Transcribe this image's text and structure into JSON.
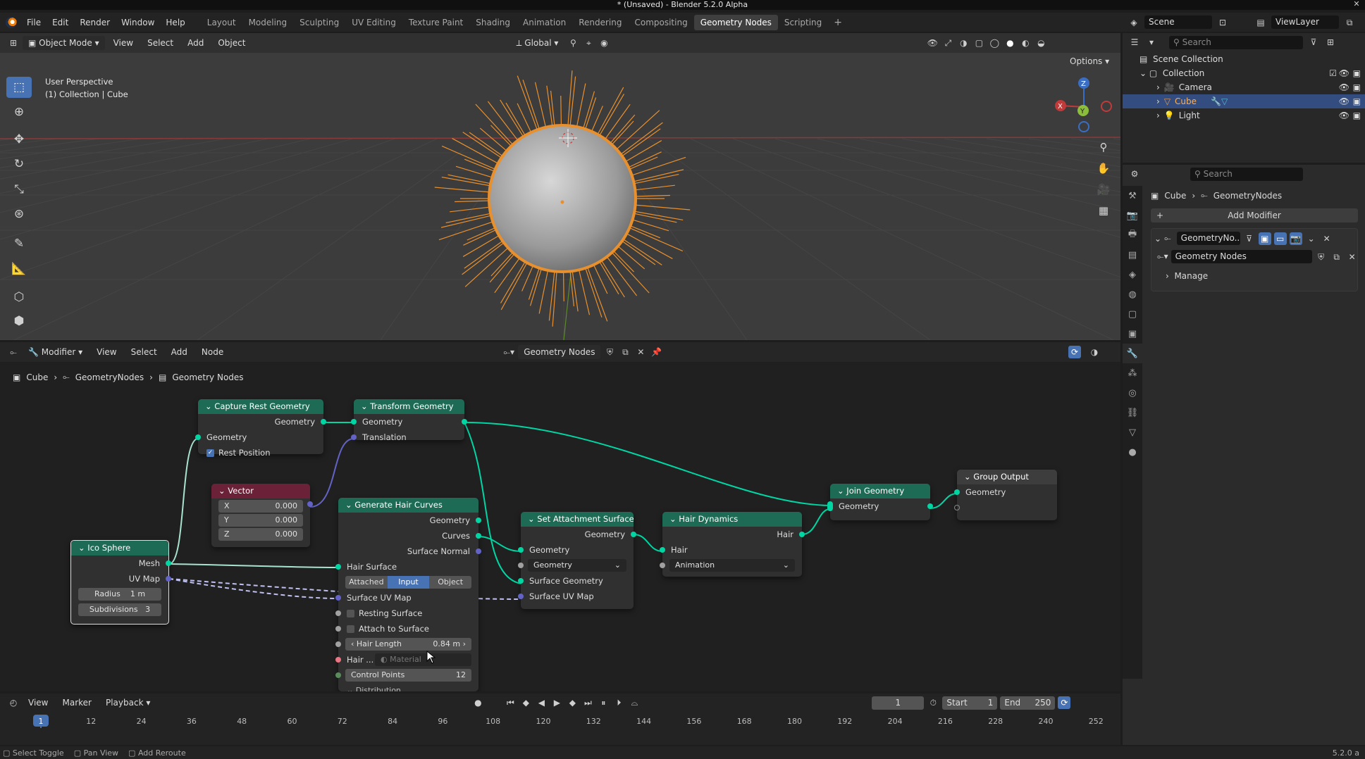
{
  "window": {
    "title": "* (Unsaved) - Blender 5.2.0 Alpha"
  },
  "menu": {
    "items": [
      "File",
      "Edit",
      "Render",
      "Window",
      "Help"
    ],
    "workspaces": [
      "Layout",
      "Modeling",
      "Sculpting",
      "UV Editing",
      "Texture Paint",
      "Shading",
      "Animation",
      "Rendering",
      "Compositing",
      "Geometry Nodes",
      "Scripting"
    ],
    "active_workspace": "Geometry Nodes",
    "scene": "Scene",
    "view_layer": "ViewLayer"
  },
  "viewport": {
    "mode": "Object Mode",
    "menus": [
      "View",
      "Select",
      "Add",
      "Object"
    ],
    "orientation": "Global",
    "options": "Options",
    "info_line1": "User Perspective",
    "info_line2": "(1) Collection | Cube",
    "gizmo": {
      "x": "X",
      "y": "Y",
      "z": "Z"
    }
  },
  "outliner": {
    "search_placeholder": "Search",
    "scene_collection": "Scene Collection",
    "collection": "Collection",
    "items": [
      {
        "name": "Camera"
      },
      {
        "name": "Cube"
      },
      {
        "name": "Light"
      }
    ]
  },
  "properties": {
    "search_placeholder": "Search",
    "breadcrumb_object": "Cube",
    "breadcrumb_modifier": "GeometryNodes",
    "add_modifier": "Add Modifier",
    "modifier_name": "GeometryNo...",
    "node_group": "Geometry Nodes",
    "manage": "Manage"
  },
  "node_editor": {
    "editor_type": "Modifier",
    "menus": [
      "View",
      "Select",
      "Add",
      "Node"
    ],
    "node_group": "Geometry Nodes",
    "breadcrumb": [
      "Cube",
      "GeometryNodes",
      "Geometry Nodes"
    ],
    "nodes": {
      "capture": {
        "title": "Capture Rest Geometry",
        "out_geometry": "Geometry",
        "in_geometry": "Geometry",
        "rest_position": "Rest Position"
      },
      "transform": {
        "title": "Transform Geometry",
        "in_geometry": "Geometry",
        "translation": "Translation"
      },
      "vector": {
        "title": "Vector",
        "x_label": "X",
        "x": "0.000",
        "y_label": "Y",
        "y": "0.000",
        "z_label": "Z",
        "z": "0.000"
      },
      "ico": {
        "title": "Ico Sphere",
        "mesh": "Mesh",
        "uvmap": "UV Map",
        "radius_label": "Radius",
        "radius": "1 m",
        "subdiv_label": "Subdivisions",
        "subdiv": "3"
      },
      "hair": {
        "title": "Generate Hair Curves",
        "out_geometry": "Geometry",
        "curves": "Curves",
        "surface_normal": "Surface Normal",
        "hair_surface": "Hair Surface",
        "tabs": [
          "Attached",
          "Input",
          "Object"
        ],
        "active_tab": "Input",
        "surface_uv": "Surface UV Map",
        "resting": "Resting Surface",
        "attach": "Attach to Surface",
        "hair_length_label": "Hair Length",
        "hair_length": "0.84 m",
        "hair_mat_label": "Hair ...",
        "hair_mat_placeholder": "Material",
        "control_points_label": "Control Points",
        "control_points": "12",
        "distribution": "Distribution"
      },
      "attach": {
        "title": "Set Attachment Surface",
        "out_geometry": "Geometry",
        "in_geometry": "Geometry",
        "dropdown": "Geometry",
        "surface_geometry": "Surface Geometry",
        "surface_uv": "Surface UV Map"
      },
      "dynamics": {
        "title": "Hair Dynamics",
        "out_hair": "Hair",
        "in_hair": "Hair",
        "dropdown": "Animation"
      },
      "join": {
        "title": "Join Geometry",
        "geometry": "Geometry"
      },
      "output": {
        "title": "Group Output",
        "geometry": "Geometry"
      }
    }
  },
  "timeline": {
    "menus": [
      "View",
      "Marker",
      "Playback"
    ],
    "current_frame": "1",
    "start_label": "Start",
    "start": "1",
    "end_label": "End",
    "end": "250",
    "ticks": [
      "1",
      "12",
      "24",
      "36",
      "48",
      "60",
      "72",
      "84",
      "96",
      "108",
      "120",
      "132",
      "144",
      "156",
      "168",
      "180",
      "192",
      "204",
      "216",
      "228",
      "240",
      "252"
    ]
  },
  "status": {
    "items": [
      "Select Toggle",
      "Pan View",
      "Add Reroute"
    ],
    "version": "5.2.0 a"
  },
  "colors": {
    "accent": "#4772b3",
    "geometry_socket": "#00d6a3",
    "vector_socket": "#6363c7",
    "node_header_geo": "#1e6b55",
    "node_header_vec": "#6b2239",
    "hair": "#e8902e"
  }
}
